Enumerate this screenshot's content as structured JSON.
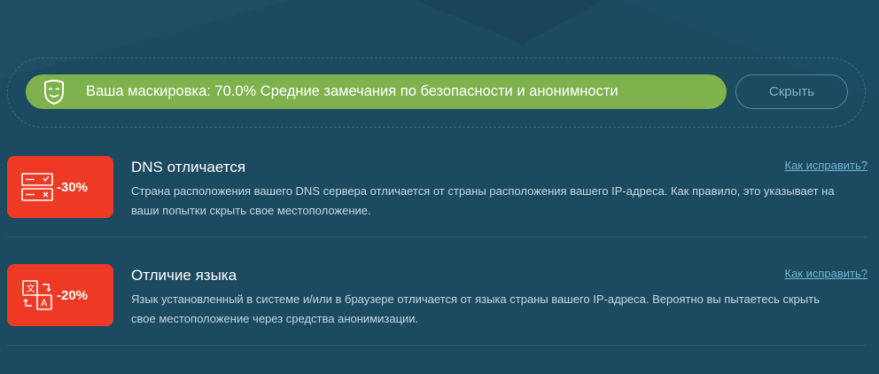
{
  "summary": {
    "text": "Ваша маскировка: 70.0% Средние замечания по безопасности и анонимности",
    "masking_percent": 70.0,
    "icon": "mask-icon",
    "hide_label": "Скрыть",
    "bar_color": "#7fb24d"
  },
  "issues": [
    {
      "badge_value": "-30%",
      "icon": "dns-server-icon",
      "title": "DNS отличается",
      "fix_link": "Как исправить?",
      "description": "Страна расположения вашего DNS сервера отличается от страны расположения вашего IP-адреса. Как правило, это указывает на ваши попытки скрыть свое местоположение."
    },
    {
      "badge_value": "-20%",
      "icon": "language-translate-icon",
      "title": "Отличие языка",
      "fix_link": "Как исправить?",
      "description": "Язык установленный в системе и/или в браузере отличается от языка страны вашего IP-адреса. Вероятно вы пытаетесь скрыть свое местоположение через средства анонимизации."
    }
  ],
  "colors": {
    "background": "#1c4a60",
    "badge": "#ee3a24",
    "link": "#72b4d4"
  }
}
